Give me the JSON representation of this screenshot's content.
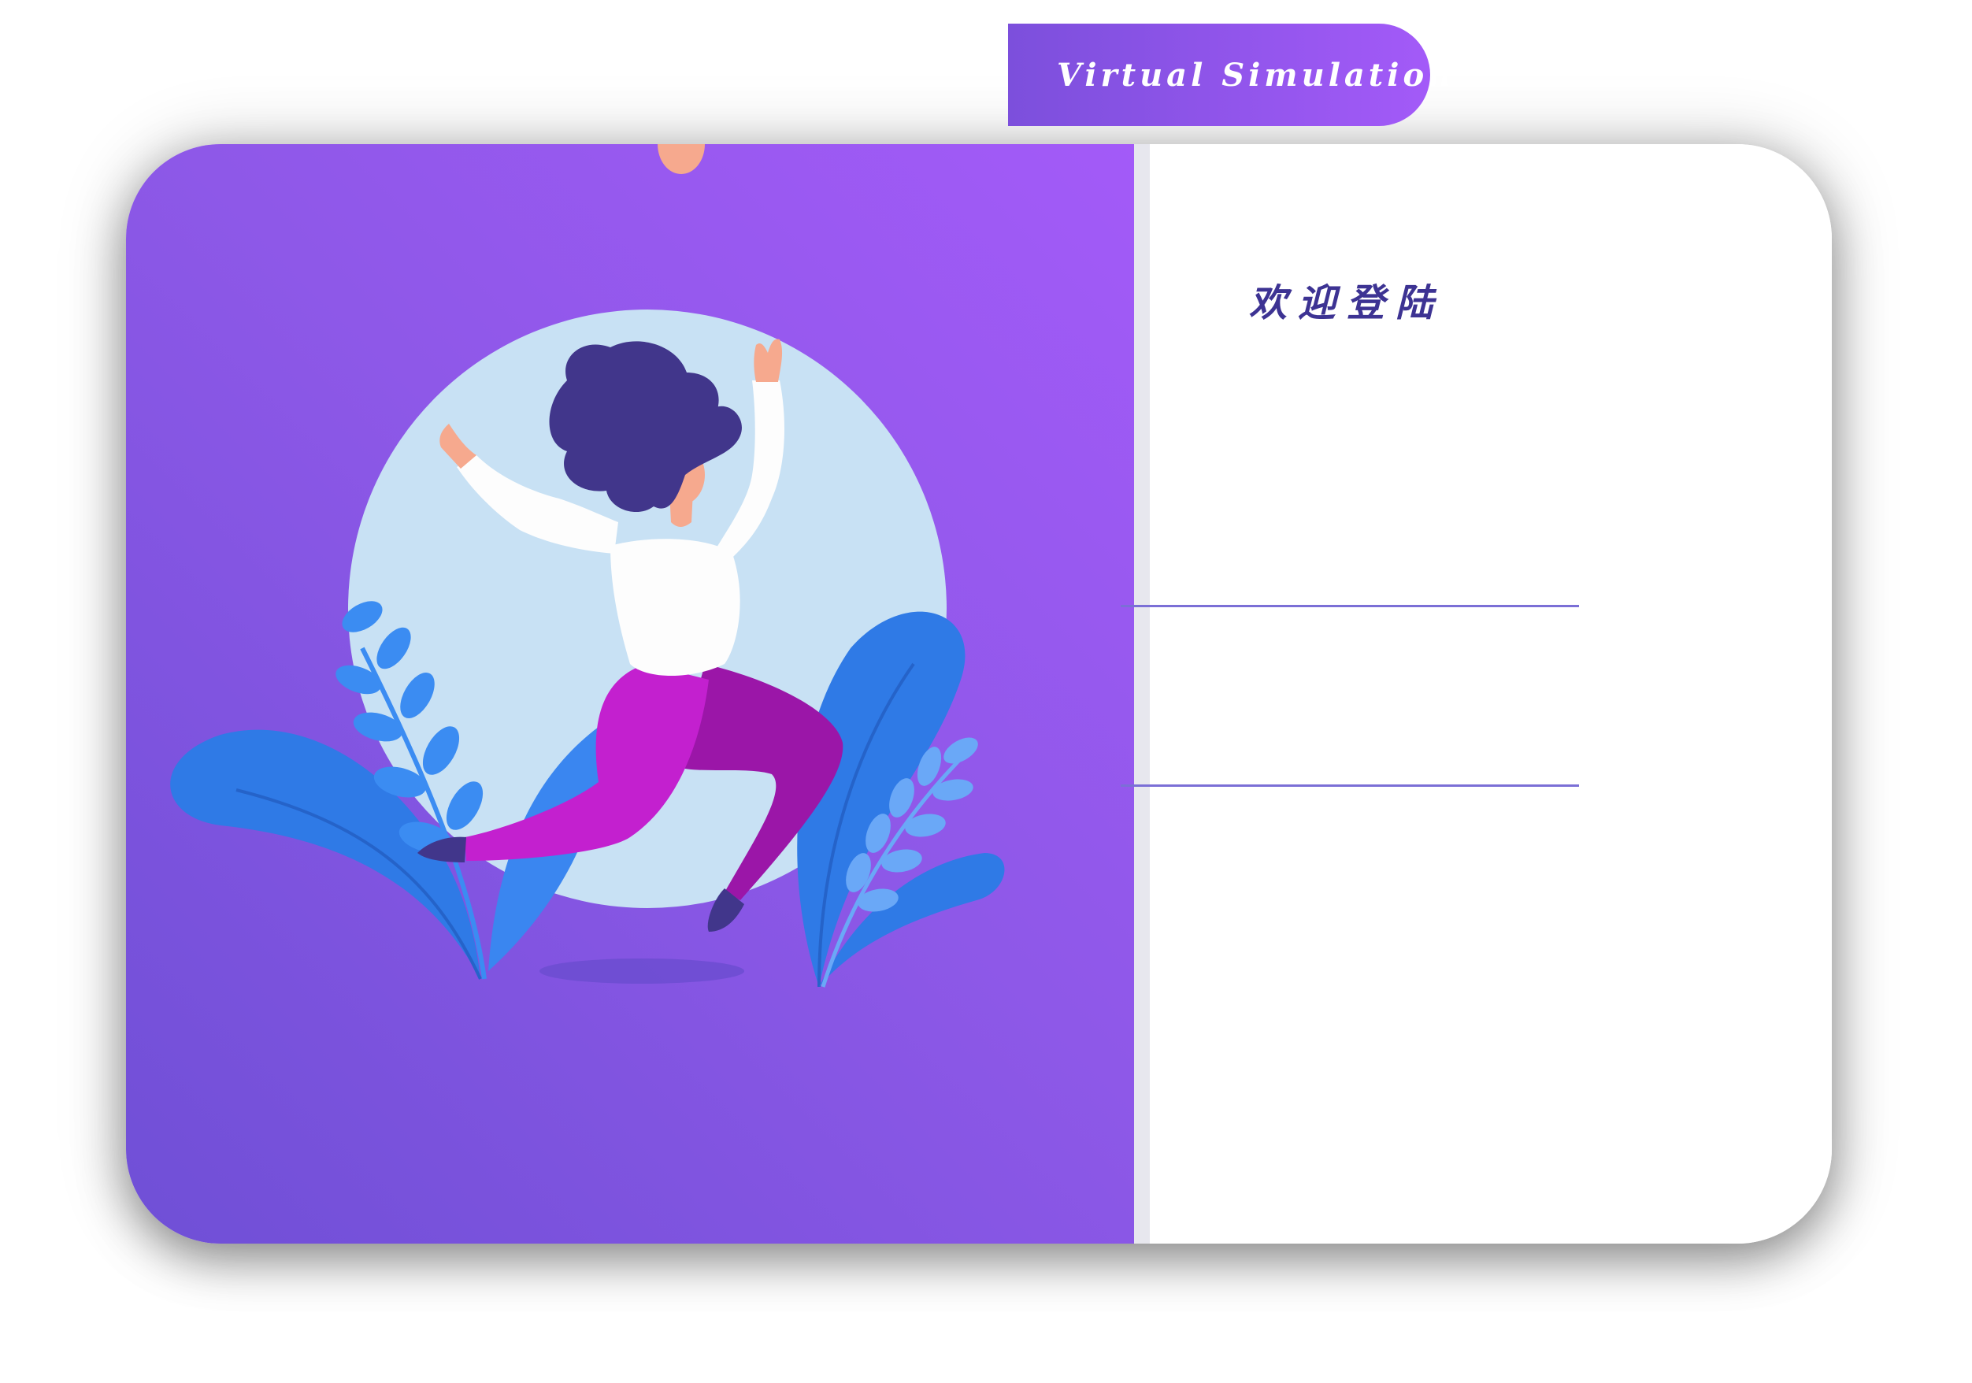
{
  "header": {
    "banner_text": "Virtual Simulation"
  },
  "login": {
    "welcome_text": "欢迎登陆",
    "username": {
      "value": "",
      "placeholder": ""
    },
    "password": {
      "value": "",
      "placeholder": ""
    }
  },
  "colors": {
    "gradient_start": "#6f4fd6",
    "gradient_end": "#a35af8",
    "welcome_text": "#3d3393",
    "field_underline": "#7b6fd6",
    "circle": "#c8e1f4",
    "hair": "#41368b",
    "pants": "#b41fc8",
    "leaves": "#2f7ae6"
  },
  "illustration": {
    "icon": "woman-jumping-with-plants-illustration"
  }
}
